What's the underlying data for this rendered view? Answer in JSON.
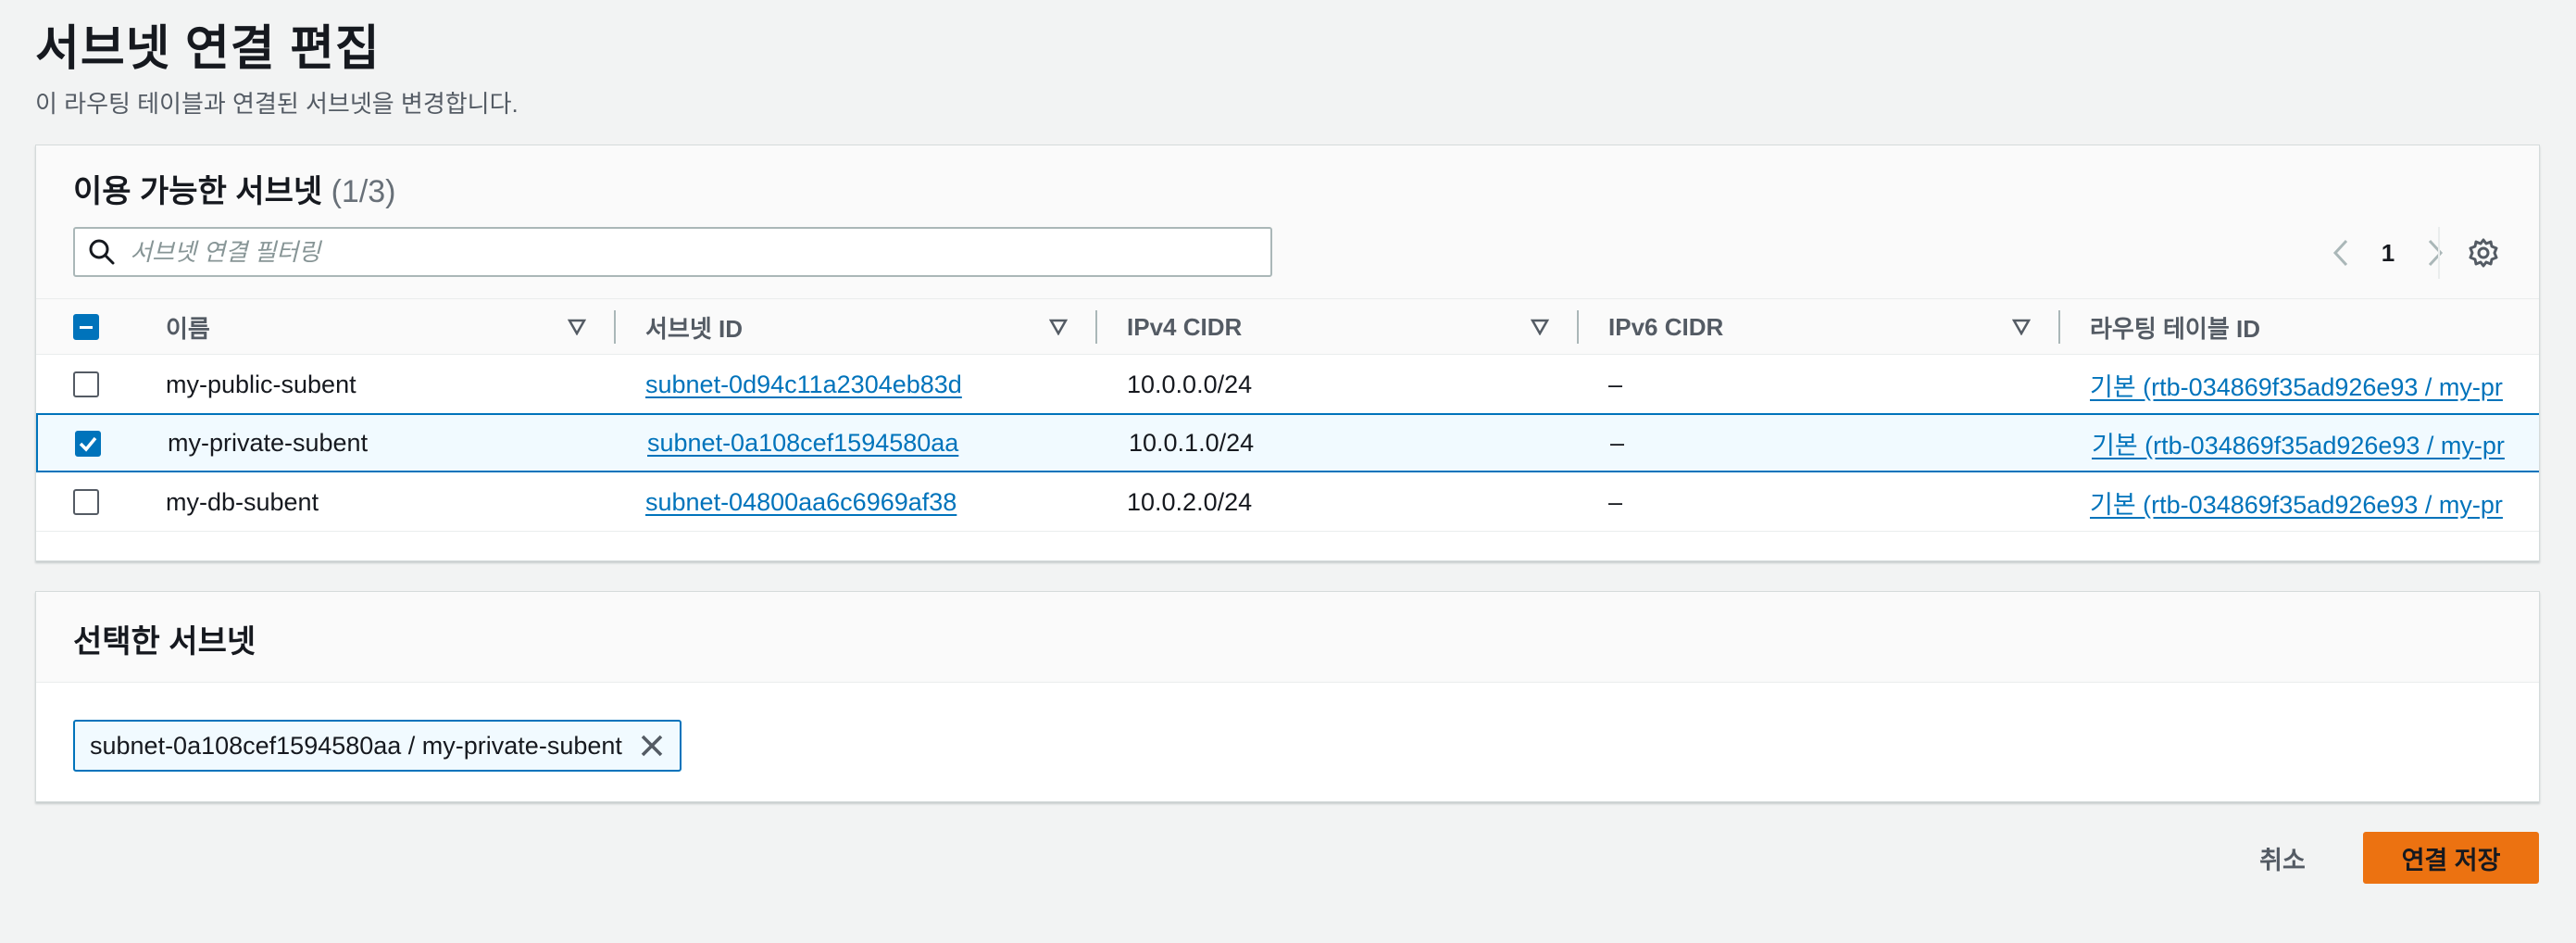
{
  "page": {
    "title": "서브넷 연결 편집",
    "description": "이 라우팅 테이블과 연결된 서브넷을 변경합니다."
  },
  "available": {
    "title": "이용 가능한 서브넷",
    "count": "(1/3)",
    "search_placeholder": "서브넷 연결 필터링",
    "page_number": "1",
    "columns": [
      "이름",
      "서브넷 ID",
      "IPv4 CIDR",
      "IPv6 CIDR",
      "라우팅 테이블 ID"
    ],
    "rows": [
      {
        "name": "my-public-subent",
        "subnet_id": "subnet-0d94c11a2304eb83d",
        "ipv4": "10.0.0.0/24",
        "ipv6": "–",
        "rtb": "기본 (rtb-034869f35ad926e93 / my-pr",
        "checked": false
      },
      {
        "name": "my-private-subent",
        "subnet_id": "subnet-0a108cef1594580aa",
        "ipv4": "10.0.1.0/24",
        "ipv6": "–",
        "rtb": "기본 (rtb-034869f35ad926e93 / my-pr",
        "checked": true
      },
      {
        "name": "my-db-subent",
        "subnet_id": "subnet-04800aa6c6969af38",
        "ipv4": "10.0.2.0/24",
        "ipv6": "–",
        "rtb": "기본 (rtb-034869f35ad926e93 / my-pr",
        "checked": false
      }
    ]
  },
  "selected": {
    "title": "선택한 서브넷",
    "token_label": "subnet-0a108cef1594580aa / my-private-subent"
  },
  "actions": {
    "cancel_label": "취소",
    "save_label": "연결 저장"
  },
  "colors": {
    "accent": "#0073bb",
    "primary_button": "#ec7211",
    "background": "#f2f3f3"
  }
}
